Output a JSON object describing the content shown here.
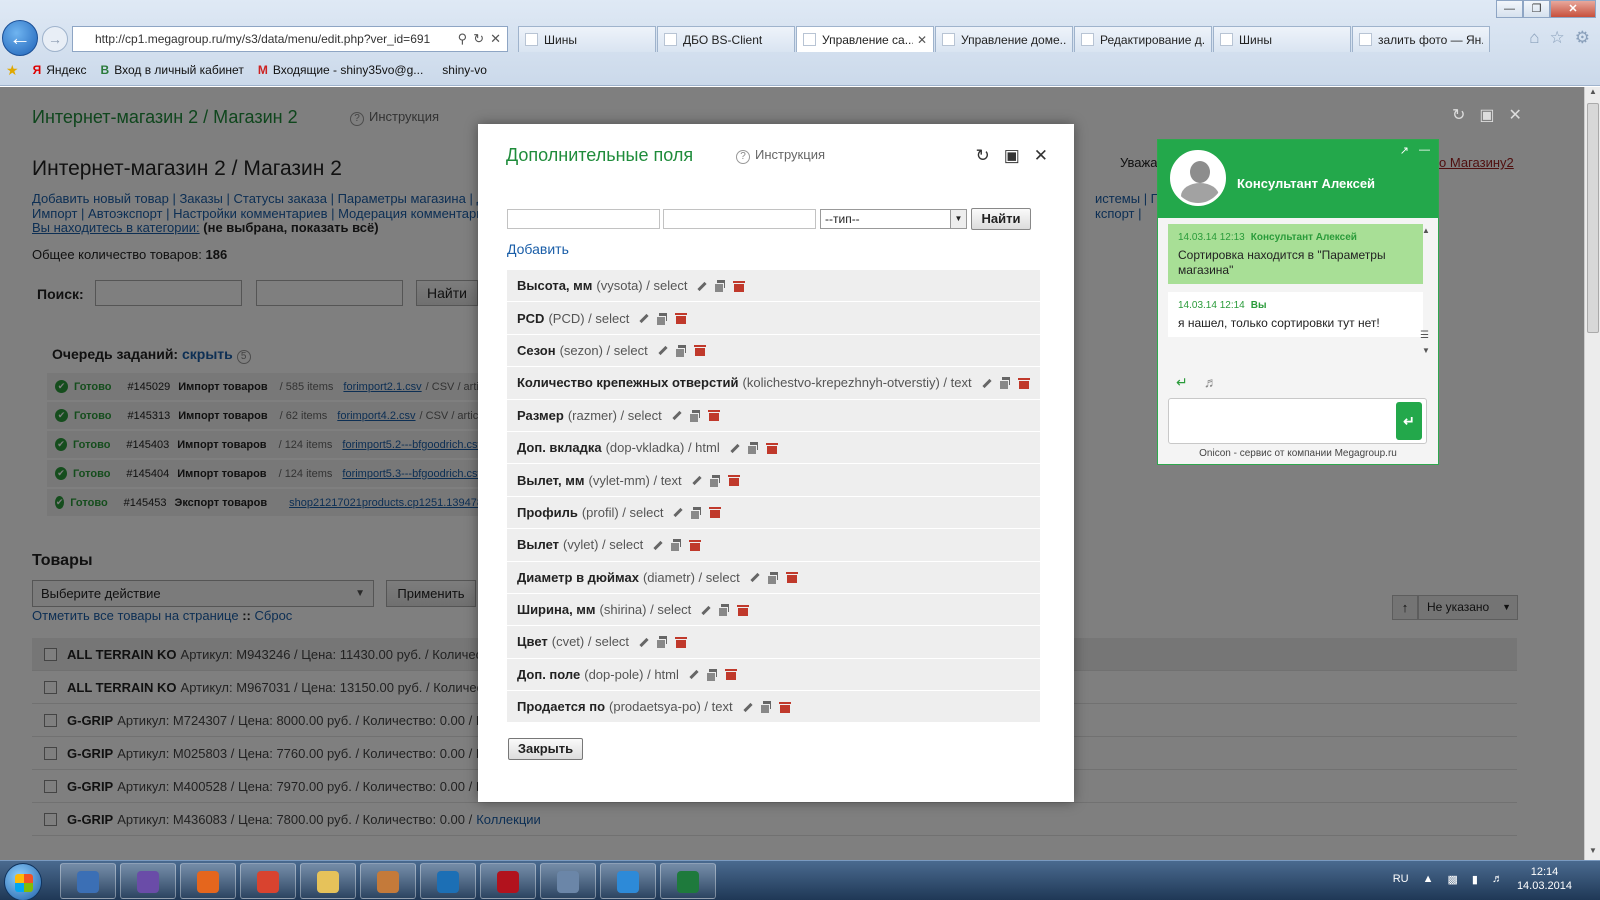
{
  "browser": {
    "url": "http://cp1.megagroup.ru/my/s3/data/menu/edit.php?ver_id=691",
    "tabs": [
      {
        "label": "Шины",
        "active": false,
        "close": false
      },
      {
        "label": "ДБО BS-Client",
        "active": false,
        "close": false
      },
      {
        "label": "Управление са...",
        "active": true,
        "close": true
      },
      {
        "label": "Управление доме...",
        "active": false,
        "close": false
      },
      {
        "label": "Редактирование д...",
        "active": false,
        "close": false
      },
      {
        "label": "Шины",
        "active": false,
        "close": false
      },
      {
        "label": "залить фото — Ян...",
        "active": false,
        "close": false
      }
    ],
    "bookmarks": [
      {
        "label": "Яндекс",
        "icon": "yandex-icon",
        "glyph": "Я"
      },
      {
        "label": "Вход в личный кабинет",
        "icon": "page-icon",
        "glyph": "B"
      },
      {
        "label": "Входящие - shiny35vo@g...",
        "icon": "gmail-icon",
        "glyph": "M"
      },
      {
        "label": "shiny-vo",
        "icon": "page-icon",
        "glyph": ""
      }
    ]
  },
  "page": {
    "shop_title": "Интернет-магазин 2 / Магазин 2",
    "help_label": "Инструкция",
    "h1": "Интернет-магазин 2 / Магазин 2",
    "links_line1": "Добавить новый товар | Заказы | Статусы заказа | Параметры магазина | Д",
    "links_line2": "Импорт | Автоэкспорт | Настройки комментариев | Модерация комментарие",
    "links_right_line1": "истемы | Прои",
    "links_right_line2": "кспорт |",
    "right_partial_text": "Уважа",
    "right_partial_link": "по Магазину2",
    "category_label": "Вы находитесь в категории:",
    "category_value": "(не выбрана, показать всё)",
    "total_label": "Общее количество товаров:",
    "total_value": "186",
    "search_label": "Поиск:",
    "search_button": "Найти",
    "queue_title": "Очередь заданий:",
    "queue_hide": "скрыть",
    "queue_count": "5",
    "queue": [
      {
        "status": "Готово",
        "id": "#145029",
        "name": "Импорт товаров",
        "count": "/ 585 items",
        "file": "forimport2.1.csv",
        "tail": "/ CSV / artic"
      },
      {
        "status": "Готово",
        "id": "#145313",
        "name": "Импорт товаров",
        "count": "/ 62 items",
        "file": "forimport4.2.csv",
        "tail": "/ CSV / article"
      },
      {
        "status": "Готово",
        "id": "#145403",
        "name": "Импорт товаров",
        "count": "/ 124 items",
        "file": "forimport5.2---bfgoodrich.csv",
        "tail": ""
      },
      {
        "status": "Готово",
        "id": "#145404",
        "name": "Импорт товаров",
        "count": "/ 124 items",
        "file": "forimport5.3---bfgoodrich.csv",
        "tail": ""
      },
      {
        "status": "Готово",
        "id": "#145453",
        "name": "Экспорт товаров",
        "count": "",
        "file": "shop21217021products.cp1251.139478",
        "tail": ""
      }
    ],
    "products_title": "Товары",
    "action_select": "Выберите действие",
    "apply_button": "Применить",
    "mark_all": "Отметить все товары на странице",
    "mark_sep": "::",
    "reset": "Сброс",
    "sort_value": "Не указано",
    "products": [
      {
        "name": "ALL TERRAIN KO",
        "details": "Артикул: M943246 / Цена: 11430.00 руб. / Количест"
      },
      {
        "name": "ALL TERRAIN KO",
        "details": "Артикул: M967031 / Цена: 13150.00 руб. / Количест"
      },
      {
        "name": "G-GRIP",
        "details": "Артикул: M724307 / Цена: 8000.00 руб. / Количество: 0.00 / К"
      },
      {
        "name": "G-GRIP",
        "details": "Артикул: M025803 / Цена: 7760.00 руб. / Количество: 0.00 / К"
      },
      {
        "name": "G-GRIP",
        "details": "Артикул: M400528 / Цена: 7970.00 руб. / Количество: 0.00 / К"
      },
      {
        "name": "G-GRIP",
        "details": "Артикул: M436083 / Цена: 7800.00 руб. / Количество: 0.00 /",
        "link": "Коллекции"
      }
    ]
  },
  "dialog": {
    "title": "Дополнительные поля",
    "help_label": "Инструкция",
    "type_select": "--тип--",
    "find_button": "Найти",
    "add_link": "Добавить",
    "close_button": "Закрыть",
    "fields": [
      {
        "name": "Высота, мм",
        "meta": "(vysota) / select"
      },
      {
        "name": "PCD",
        "meta": "(PCD) / select"
      },
      {
        "name": "Сезон",
        "meta": "(sezon) / select"
      },
      {
        "name": "Количество крепежных отверстий",
        "meta": "(kolichestvo-krepezhnyh-otverstiy) / text"
      },
      {
        "name": "Размер",
        "meta": "(razmer) / select"
      },
      {
        "name": "Доп. вкладка",
        "meta": "(dop-vkladka) / html"
      },
      {
        "name": "Вылет, мм",
        "meta": "(vylet-mm) / text"
      },
      {
        "name": "Профиль",
        "meta": "(profil) / select"
      },
      {
        "name": "Вылет",
        "meta": "(vylet) / select"
      },
      {
        "name": "Диаметр в дюймах",
        "meta": "(diametr) / select"
      },
      {
        "name": "Ширина, мм",
        "meta": "(shirina) / select"
      },
      {
        "name": "Цвет",
        "meta": "(cvet) / select"
      },
      {
        "name": "Доп. поле",
        "meta": "(dop-pole) / html"
      },
      {
        "name": "Продается по",
        "meta": "(prodaetsya-po) / text"
      }
    ]
  },
  "chat": {
    "operator_name": "Консультант Алексей",
    "messages": [
      {
        "kind": "op",
        "date": "14.03.14",
        "time": "12:13",
        "author": "Консультант Алексей",
        "text": "Сортировка находится в \"Параметры магазина\""
      },
      {
        "kind": "me",
        "date": "14.03.14",
        "time": "12:14",
        "author": "Вы",
        "text": "я нашел, только сортировки тут нет!"
      }
    ],
    "footer": "Onicon - сервис от компании Megagroup.ru"
  },
  "taskbar": {
    "lang": "RU",
    "time": "12:14",
    "date": "14.03.2014",
    "apps": [
      {
        "name": "explorer-doc",
        "color": "#3b6fb5"
      },
      {
        "name": "visual-studio",
        "color": "#6a4ca8"
      },
      {
        "name": "firefox",
        "color": "#e5661d"
      },
      {
        "name": "chrome",
        "color": "#d9432f"
      },
      {
        "name": "folder",
        "color": "#e6c25a"
      },
      {
        "name": "pictures",
        "color": "#c47a3a"
      },
      {
        "name": "hp",
        "color": "#1c6fb5"
      },
      {
        "name": "mcafee",
        "color": "#b2121d"
      },
      {
        "name": "calculator",
        "color": "#6b86a8"
      },
      {
        "name": "internet-explorer",
        "color": "#2d8ad8"
      },
      {
        "name": "excel",
        "color": "#1e7a3c"
      }
    ]
  },
  "colors": {
    "accent_green": "#1f8c3b",
    "chat_green": "#23a84b",
    "link_blue": "#1a5ea8",
    "delete_red": "#c0392b"
  }
}
